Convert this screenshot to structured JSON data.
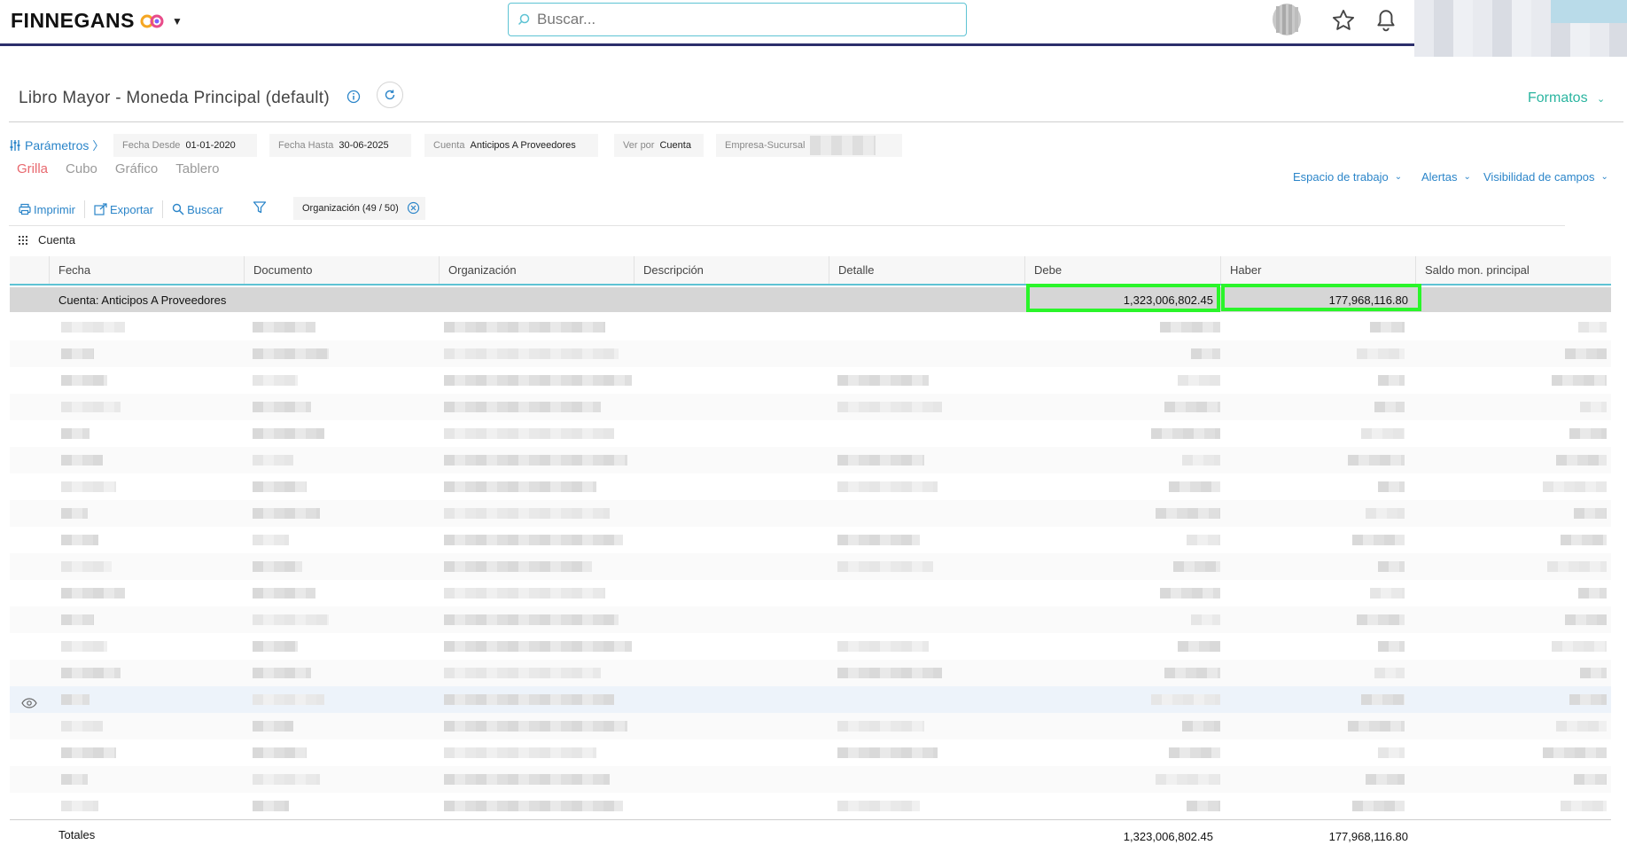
{
  "app": {
    "brand": "FINNEGANS",
    "search_placeholder": "Buscar..."
  },
  "page": {
    "title": "Libro Mayor - Moneda Principal (default)",
    "formatos_label": "Formatos"
  },
  "params": {
    "link_label": "Parámetros",
    "items": [
      {
        "label": "Fecha Desde",
        "value": "01-01-2020"
      },
      {
        "label": "Fecha Hasta",
        "value": "30-06-2025"
      },
      {
        "label": "Cuenta",
        "value": "Anticipos A Proveedores"
      },
      {
        "label": "Ver por",
        "value": "Cuenta"
      },
      {
        "label": "Empresa-Sucursal",
        "value": ""
      }
    ]
  },
  "views": [
    "Grilla",
    "Cubo",
    "Gráfico",
    "Tablero"
  ],
  "workspace_links": [
    "Espacio de trabajo",
    "Alertas",
    "Visibilidad de campos"
  ],
  "toolbar": {
    "print": "Imprimir",
    "export": "Exportar",
    "search": "Buscar",
    "org_filter": "Organización (49 / 50)"
  },
  "grouping": {
    "label": "Cuenta"
  },
  "grid": {
    "columns": [
      "Fecha",
      "Documento",
      "Organización",
      "Descripción",
      "Detalle",
      "Debe",
      "Haber",
      "Saldo mon. principal"
    ],
    "group_row": {
      "label": "Cuenta: Anticipos A Proveedores",
      "debe": "1,323,006,802.45",
      "haber": "177,968,116.80"
    },
    "totals": {
      "label": "Totales",
      "debe": "1,323,006,802.45",
      "haber": "177,968,116.80"
    }
  },
  "colors": {
    "accent_teal": "#2bb5a0",
    "link_blue": "#2b85c9",
    "active_tab": "#e8686e",
    "highlight_green": "#2af52a"
  }
}
